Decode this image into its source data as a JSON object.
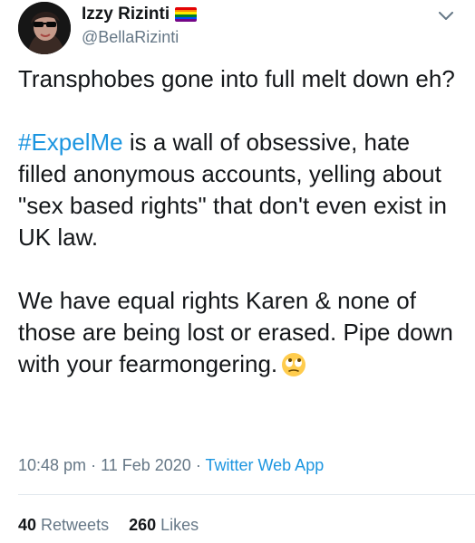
{
  "author": {
    "display_name": "Izzy Rizinti",
    "handle": "@BellaRizinti",
    "badge_icon": "rainbow-flag-emoji"
  },
  "tweet": {
    "paragraph1": "Transphobes gone into full melt down eh?",
    "hashtag": "#ExpelMe",
    "paragraph2_rest": " is a wall of obsessive, hate filled anonymous accounts, yelling about \"sex based rights\" that don't even exist in UK law.",
    "paragraph3": "We have equal rights Karen & none of those are being lost or erased. Pipe down with your fearmongering.",
    "emoji_icon": "eye-roll-emoji"
  },
  "meta": {
    "time": "10:48 pm",
    "separator1": " · ",
    "date": "11 Feb 2020",
    "separator2": " · ",
    "source": "Twitter Web App"
  },
  "stats": {
    "retweets_count": "40",
    "retweets_label": " Retweets",
    "likes_count": "260",
    "likes_label": " Likes"
  },
  "colors": {
    "link": "#1b95e0",
    "secondary": "#657786",
    "divider": "#e1e8ed"
  }
}
